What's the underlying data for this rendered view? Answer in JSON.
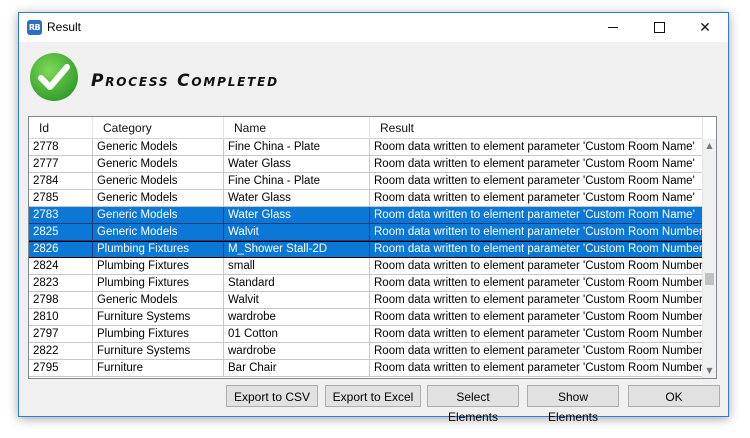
{
  "window": {
    "title": "Result"
  },
  "header": {
    "heading": "Process Completed"
  },
  "grid": {
    "columns": [
      "Id",
      "Category",
      "Name",
      "Result"
    ],
    "rows": [
      {
        "id": "2778",
        "category": "Generic Models",
        "name": "Fine China - Plate",
        "result": "Room data written to element parameter 'Custom Room Name'",
        "selected": false
      },
      {
        "id": "2777",
        "category": "Generic Models",
        "name": "Water Glass",
        "result": "Room data written to element parameter 'Custom Room Name'",
        "selected": false
      },
      {
        "id": "2784",
        "category": "Generic Models",
        "name": "Fine China - Plate",
        "result": "Room data written to element parameter 'Custom Room Name'",
        "selected": false
      },
      {
        "id": "2785",
        "category": "Generic Models",
        "name": "Water Glass",
        "result": "Room data written to element parameter 'Custom Room Name'",
        "selected": false
      },
      {
        "id": "2783",
        "category": "Generic Models",
        "name": "Water Glass",
        "result": "Room data written to element parameter 'Custom Room Name'",
        "selected": true
      },
      {
        "id": "2825",
        "category": "Generic Models",
        "name": "Walvit",
        "result": "Room data written to element parameter 'Custom Room Number'",
        "selected": true
      },
      {
        "id": "2826",
        "category": "Plumbing Fixtures",
        "name": "M_Shower Stall-2D",
        "result": "Room data written to element parameter 'Custom Room Number'",
        "selected": true,
        "focused": true
      },
      {
        "id": "2824",
        "category": "Plumbing Fixtures",
        "name": "small",
        "result": "Room data written to element parameter 'Custom Room Number'",
        "selected": false
      },
      {
        "id": "2823",
        "category": "Plumbing Fixtures",
        "name": "Standard",
        "result": "Room data written to element parameter 'Custom Room Number'",
        "selected": false
      },
      {
        "id": "2798",
        "category": "Generic Models",
        "name": "Walvit",
        "result": "Room data written to element parameter 'Custom Room Number'",
        "selected": false
      },
      {
        "id": "2810",
        "category": "Furniture Systems",
        "name": "wardrobe",
        "result": "Room data written to element parameter 'Custom Room Number'",
        "selected": false
      },
      {
        "id": "2797",
        "category": "Plumbing Fixtures",
        "name": "01 Cotton",
        "result": "Room data written to element parameter 'Custom Room Number'",
        "selected": false
      },
      {
        "id": "2822",
        "category": "Furniture Systems",
        "name": "wardrobe",
        "result": "Room data written to element parameter 'Custom Room Number'",
        "selected": false
      },
      {
        "id": "2795",
        "category": "Furniture",
        "name": "Bar Chair",
        "result": "Room data written to element parameter 'Custom Room Number'",
        "selected": false
      }
    ]
  },
  "buttons": {
    "export_csv": "Export to CSV",
    "export_excel": "Export to Excel",
    "select_elements": "Select Elements",
    "show_elements": "Show Elements",
    "ok": "OK"
  },
  "colors": {
    "selection": "#0b78d7",
    "check": "#4caf3f",
    "title_border": "#2d7bd6"
  }
}
